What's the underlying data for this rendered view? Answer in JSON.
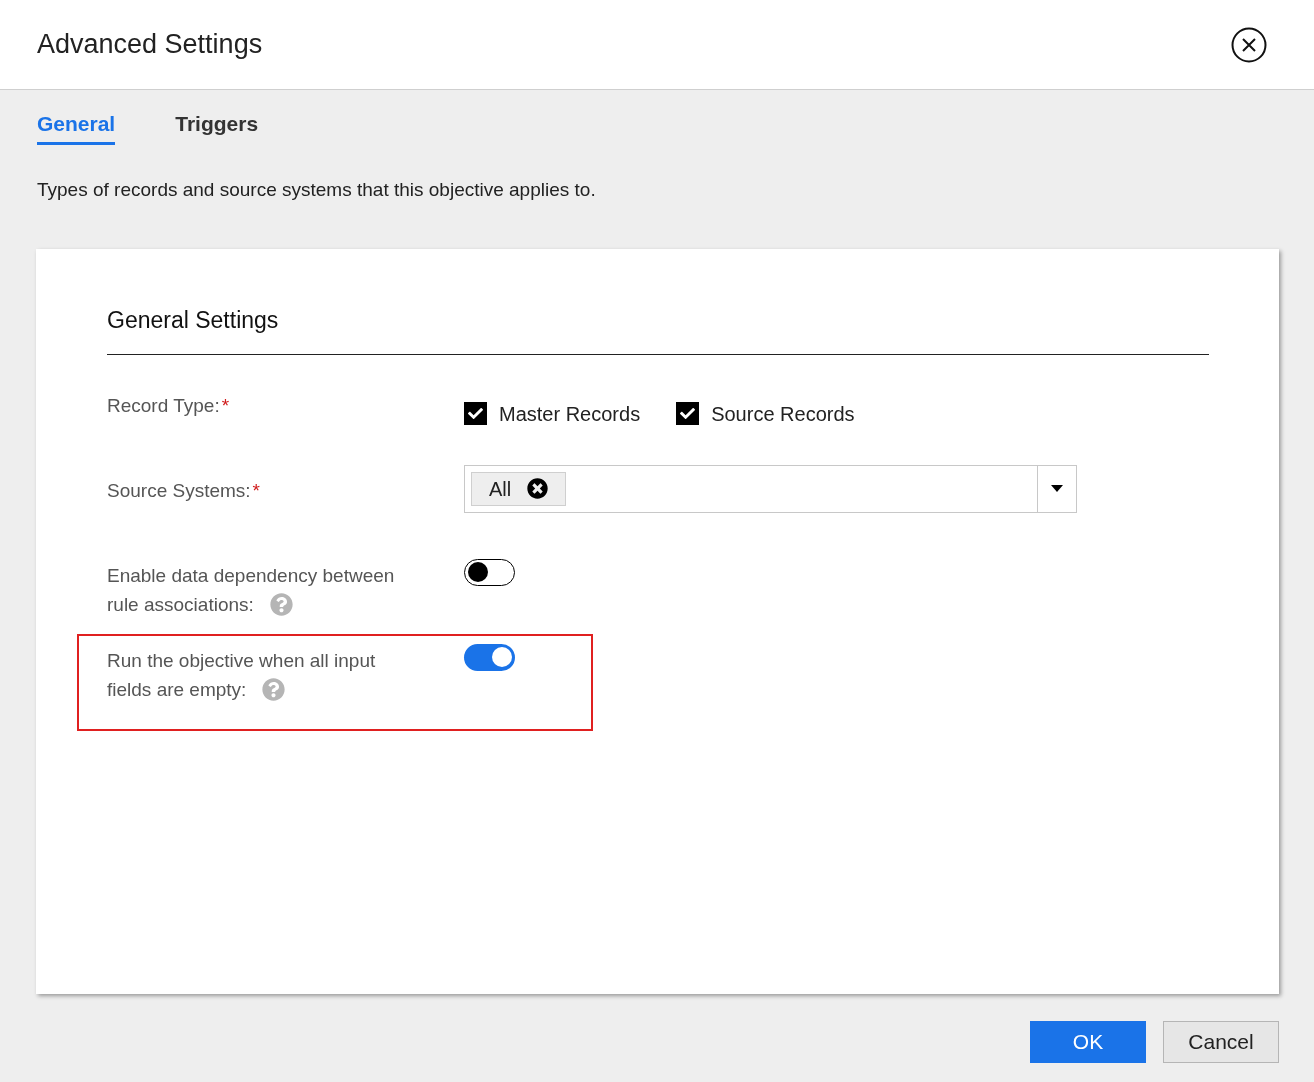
{
  "dialog": {
    "title": "Advanced Settings"
  },
  "tabs": [
    {
      "label": "General",
      "selected": true
    },
    {
      "label": "Triggers",
      "selected": false
    }
  ],
  "description": "Types of records and source systems that this objective applies to.",
  "section": {
    "title": "General Settings"
  },
  "settings": [
    {
      "kind": "checkboxes",
      "label_lines": [
        "Record Type:"
      ],
      "required_mark": "*",
      "options": [
        {
          "label": "Master Records",
          "checked": true
        },
        {
          "label": "Source Records",
          "checked": true
        }
      ]
    },
    {
      "kind": "multiselect",
      "label_lines": [
        "Source Systems:"
      ],
      "required_mark": "*",
      "chips": [
        "All"
      ]
    },
    {
      "kind": "toggle",
      "label_lines": [
        "Enable data dependency between",
        "rule associations:"
      ],
      "on": false,
      "help": true,
      "highlighted": false
    },
    {
      "kind": "toggle",
      "label_lines": [
        "Run the objective when all input",
        "fields are empty:"
      ],
      "on": true,
      "help": true,
      "highlighted": true
    }
  ],
  "buttons": [
    {
      "label": "OK",
      "primary": true
    },
    {
      "label": "Cancel",
      "primary": false
    }
  ]
}
